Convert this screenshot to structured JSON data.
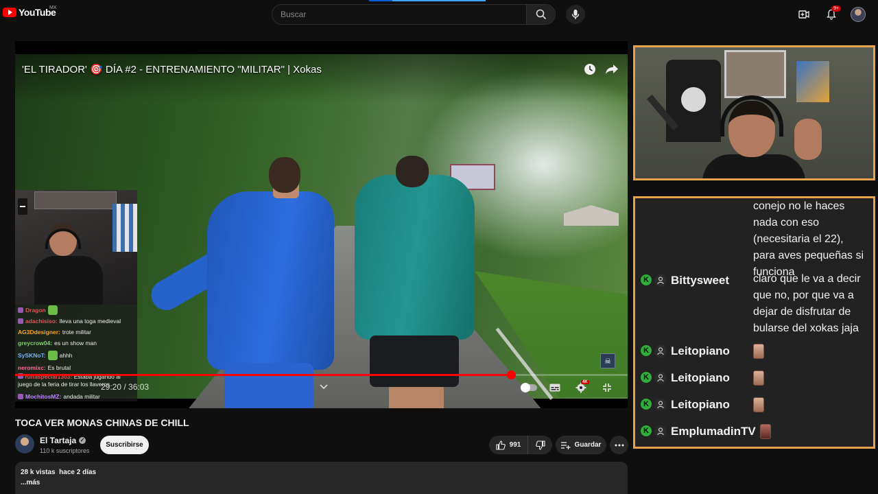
{
  "topbar": {
    "logo_text": "YouTube",
    "region": "MX",
    "search_placeholder": "Buscar",
    "notification_count": "9+"
  },
  "player": {
    "title": "'EL TIRADOR' 🎯 DÍA #2 - ENTRENAMIENTO \"MILITAR\" | Xokas",
    "time_current": "29:20",
    "time_total": "36:03",
    "time_display": "29:20 / 36:03",
    "progress_fraction": 0.81,
    "quality_badge": "4K"
  },
  "overlay_chat": [
    {
      "user": "Dragon",
      "text": "",
      "color": "#e05555"
    },
    {
      "user": "adachisiso:",
      "text": "lleva una toga medieval",
      "color": "#d65a5a"
    },
    {
      "user": "AG3Ddesigner:",
      "text": "trote militar",
      "color": "#f5a623"
    },
    {
      "user": "greycrow04:",
      "text": "es un show man",
      "color": "#7fd36b"
    },
    {
      "user": "SySKNoT:",
      "text": "ahhh",
      "color": "#6fb5ff"
    },
    {
      "user": "neromixc:",
      "text": "Es brutal",
      "color": "#ff6b9d"
    },
    {
      "user": "runaspecial1303:",
      "text": "Estaba jugando al juego de la feria de tirar los llaveros",
      "color": "#d65a5a"
    },
    {
      "user": "MochitosMZ:",
      "text": "andada militar",
      "color": "#b982ff"
    }
  ],
  "video_info": {
    "page_title": "TOCA VER MONAS CHINAS DE CHILL",
    "channel_name": "El Tartaja",
    "subscribers": "110 k suscriptores",
    "subscribe_label": "Suscribirse",
    "likes": "991",
    "save_label": "Guardar",
    "views": "28 k vistas",
    "date": "hace 2 días",
    "more": "...más"
  },
  "stream_chat": {
    "continued_text": "conejo no le haces nada con eso (necesitaria el 22), para aves pequeñas si funciona",
    "messages": [
      {
        "user": "Bittysweet",
        "text": "claro que le va a decir que no, por que va a dejar de disfrutar de bularse del xokas jaja"
      },
      {
        "user": "Leitopiano",
        "text": ""
      },
      {
        "user": "Leitopiano",
        "text": ""
      },
      {
        "user": "Leitopiano",
        "text": ""
      },
      {
        "user": "EmplumadinTV",
        "text": ""
      }
    ],
    "badge_letter": "K"
  },
  "colors": {
    "accent": "#ff0000",
    "panel_border": "#e8a24a",
    "chat_badge": "#2fae3a"
  }
}
